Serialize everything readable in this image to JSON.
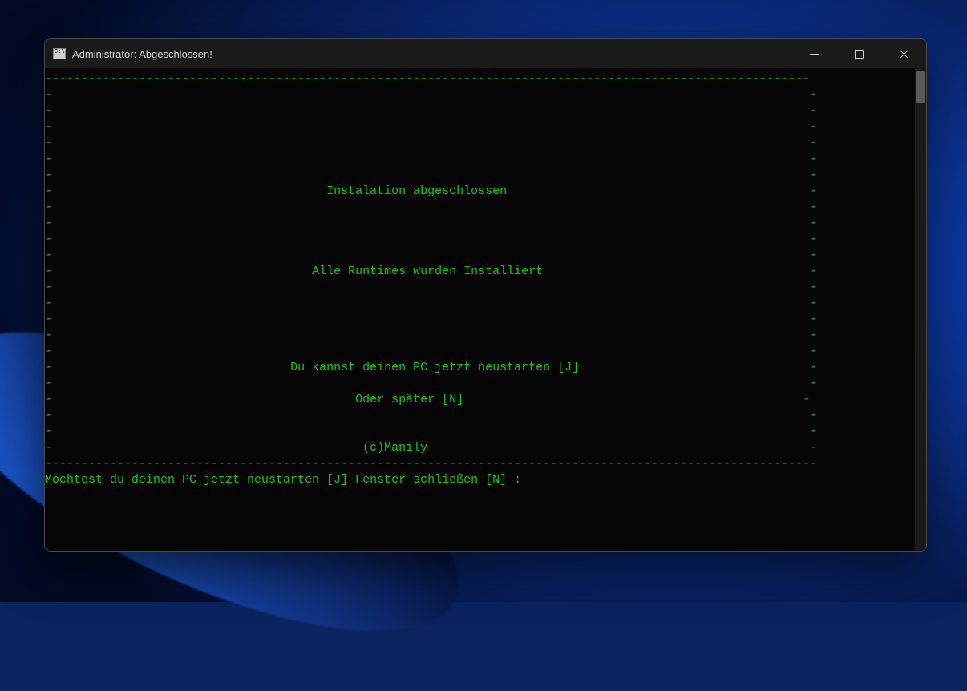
{
  "window": {
    "title": "Administrator:  Abgeschlossen!"
  },
  "terminal": {
    "topBorder": "----------------------------------------------------------------------------------------------------------",
    "leftBar": "-",
    "rightBar": "-",
    "msgInstallDone": "Instalation abgeschlossen",
    "msgRuntimes": "Alle Runtimes wurden Installiert",
    "msgRestart": "Du kannst deinen PC jetzt neustarten [J]",
    "msgLater": "Oder später [N]",
    "msgCopyright": "(c)Manily",
    "bottomBorder": "-----------------------------------------------------------------------------------------------------------",
    "prompt": "Möchtest du deinen PC jetzt neustarten [J] Fenster schließen [N] :"
  },
  "padding": {
    "empty": "                                      ",
    "installDone": "                                      ",
    "runtimes": "                                    ",
    "restart": "                                 ",
    "later": "                                          ",
    "copyright": "                                           "
  }
}
